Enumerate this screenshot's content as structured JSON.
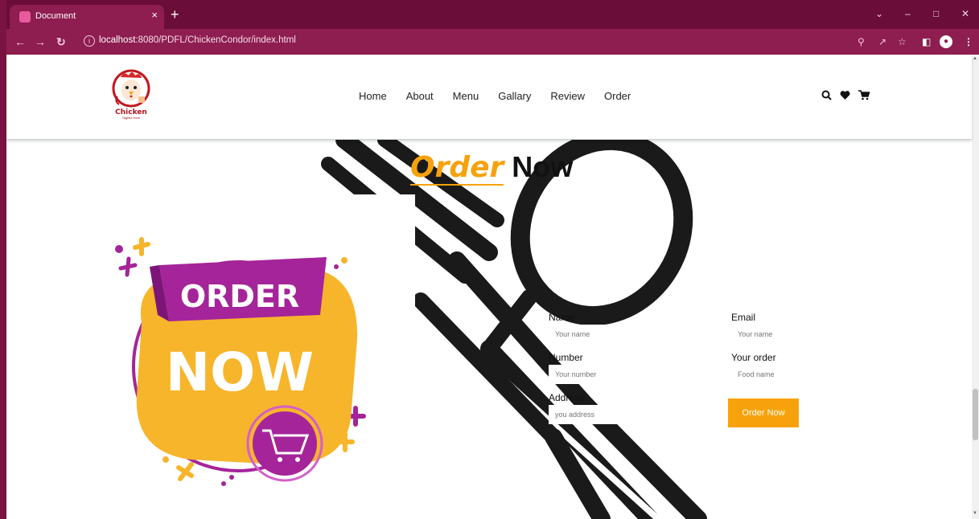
{
  "browser": {
    "tab_title": "Document",
    "tab_close": "×",
    "new_tab": "+",
    "url_host": "localhost",
    "url_path": ":8080/PDFL/ChickenCondor/index.html"
  },
  "header": {
    "logo_text": "Chicken",
    "logo_tagline": "Tagline Here",
    "nav": [
      "Home",
      "About",
      "Menu",
      "Gallary",
      "Review",
      "Order"
    ],
    "icons": [
      "search-icon",
      "heart-icon",
      "cart-icon"
    ]
  },
  "order": {
    "title_accent": "Order",
    "title_rest": "Now",
    "promo_top": "ORDER",
    "promo_bottom": "NOW",
    "fields": {
      "name_label": "Name",
      "name_placeholder": "Your name",
      "email_label": "Email",
      "email_placeholder": "Your name",
      "number_label": "Number",
      "number_placeholder": "Your number",
      "order_label": "Your order",
      "order_placeholder": "Food name",
      "address_label": "Address",
      "address_placeholder": "you address"
    },
    "submit_label": "Order Now"
  },
  "colors": {
    "accent": "#f7a20c",
    "browser_frame": "#6a0d38",
    "promo_purple": "#a5249a",
    "promo_yellow": "#f7b52c"
  }
}
